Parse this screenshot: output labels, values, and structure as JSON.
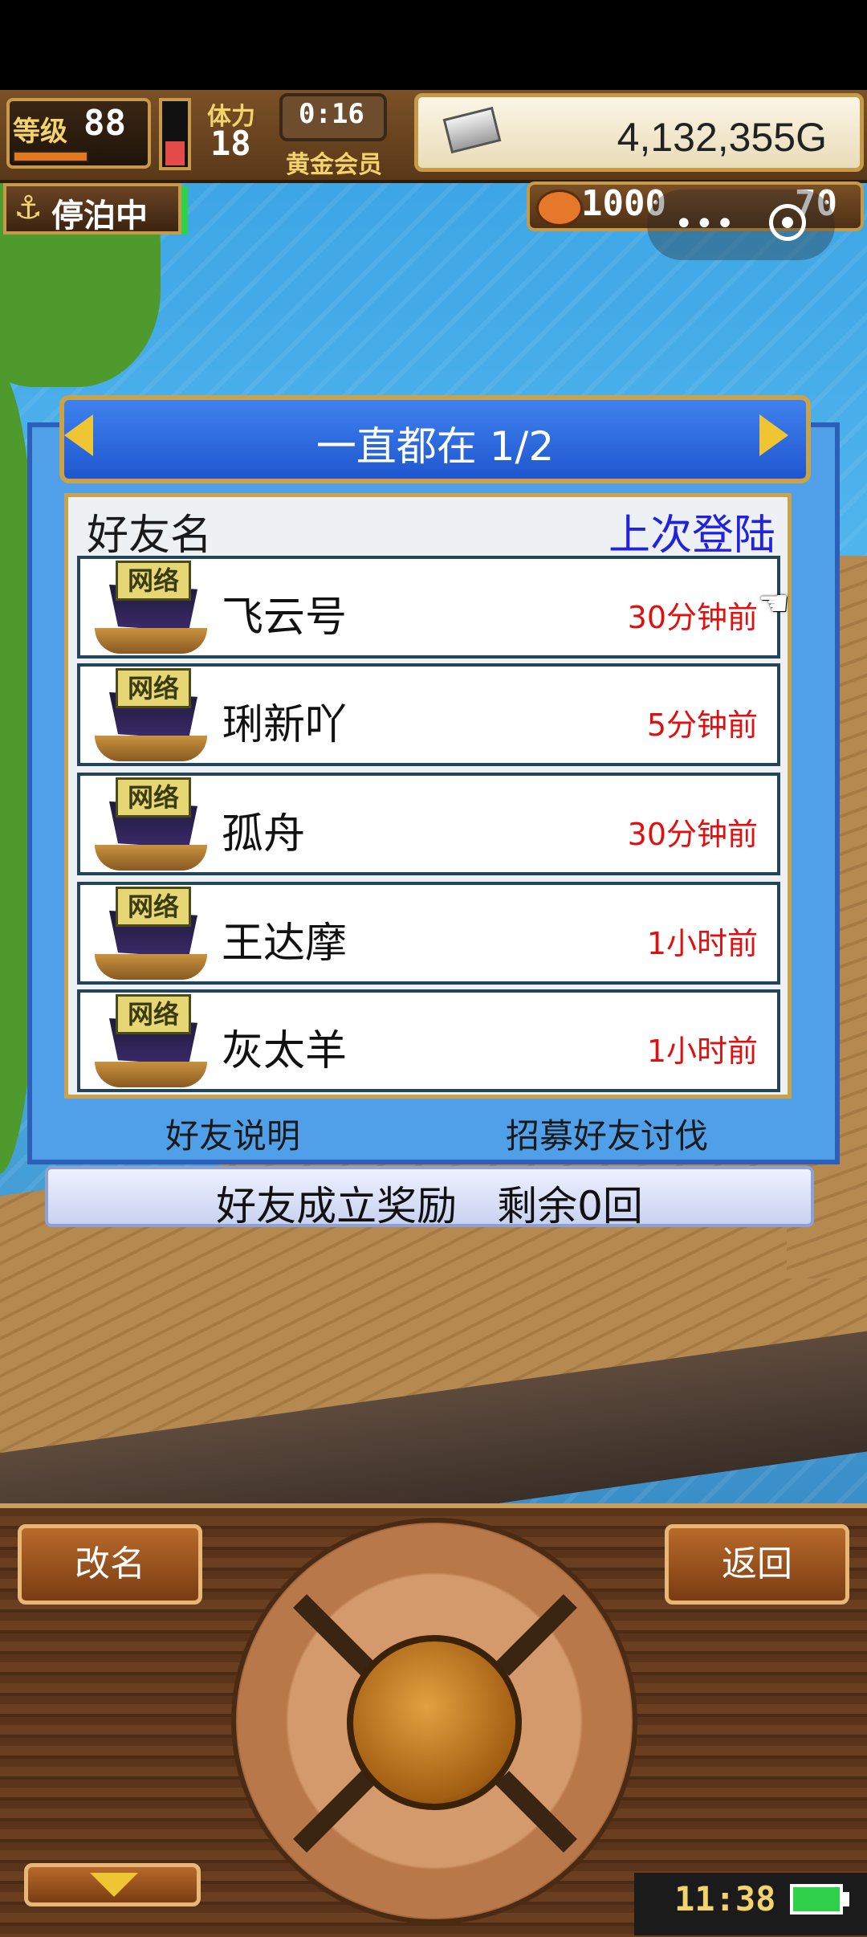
{
  "hud": {
    "level_label": "等级",
    "level": "88",
    "stamina_label": "体力",
    "stamina": "18",
    "timer": "0:16",
    "member_label": "黄金会员",
    "gold": "4,132,355G",
    "anchor_status": "停泊中",
    "food": "1000",
    "coins": "70"
  },
  "dialog": {
    "title": "一直都在 1/2",
    "column_friend": "好友名",
    "column_last_login": "上次登陆",
    "ship_tag": "网络",
    "rows": [
      {
        "name": "飞云号",
        "last_login": "30分钟前"
      },
      {
        "name": "琍新吖",
        "last_login": "5分钟前"
      },
      {
        "name": "孤舟",
        "last_login": "30分钟前"
      },
      {
        "name": "王达摩",
        "last_login": "1小时前"
      },
      {
        "name": "灰太羊",
        "last_login": "1小时前"
      }
    ],
    "friend_help": "好友说明",
    "recruit": "招募好友讨伐",
    "reward": "好友成立奖励　剩余0回"
  },
  "controls": {
    "rename": "改名",
    "back": "返回"
  },
  "status": {
    "clock": "11:38"
  },
  "colors": {
    "dialog_blue": "#4fa0e8",
    "header_blue": "#1f56cf",
    "time_red": "#e01010",
    "login_blue": "#2222dd",
    "gold_border": "#c9a24a"
  }
}
